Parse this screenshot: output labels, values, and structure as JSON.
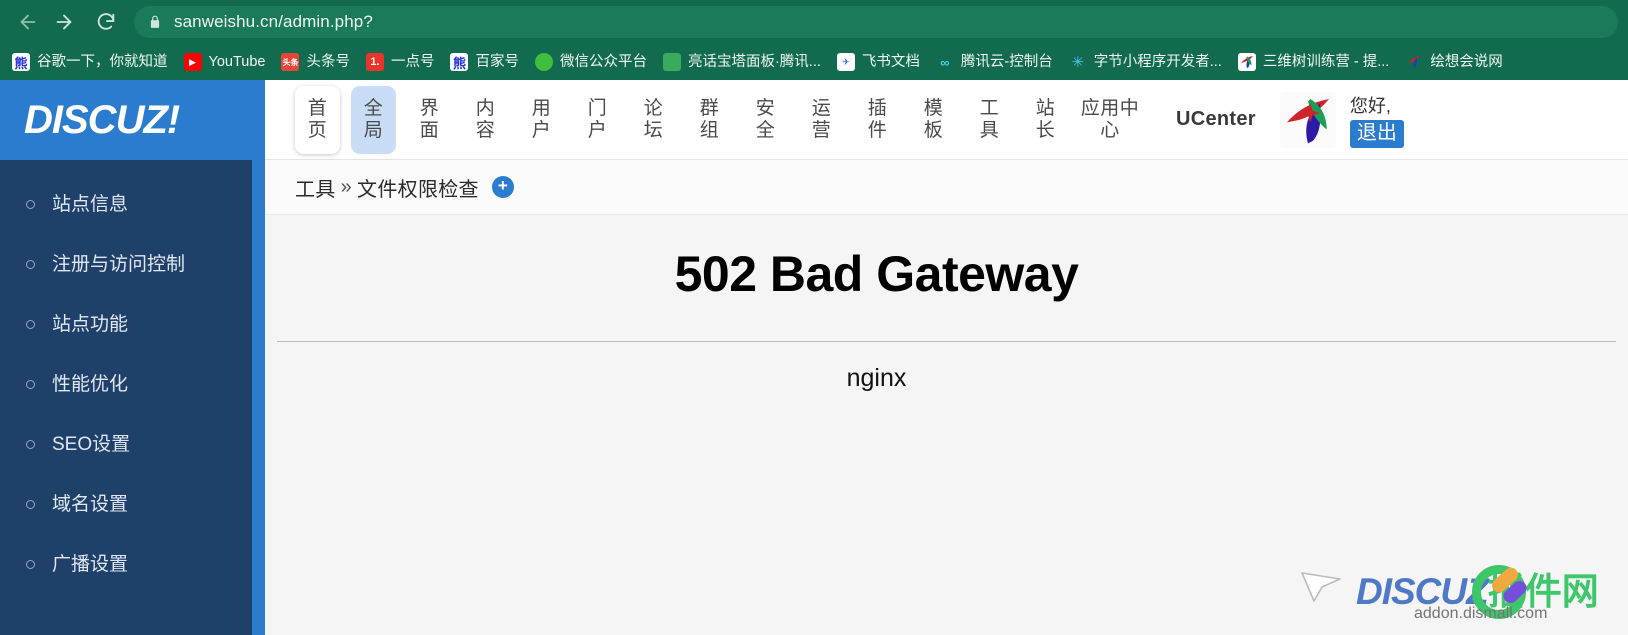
{
  "browser": {
    "url": "sanweishu.cn/admin.php?",
    "back_icon": "back-arrow-icon",
    "forward_icon": "forward-arrow-icon",
    "reload_icon": "reload-icon",
    "lock_icon": "lock-icon",
    "chrome_color": "#126b4e",
    "bookmarks": [
      {
        "label": "谷歌一下，你就知道",
        "icon": "baidu-icon",
        "glyph": "熊",
        "cls": "ico-baidu"
      },
      {
        "label": "YouTube",
        "icon": "youtube-icon",
        "glyph": "▶",
        "cls": "ico-youtube"
      },
      {
        "label": "头条号",
        "icon": "toutiao-icon",
        "glyph": "头条",
        "cls": "ico-toutiao"
      },
      {
        "label": "一点号",
        "icon": "yidian-icon",
        "glyph": "1.",
        "cls": "ico-yidian"
      },
      {
        "label": "百家号",
        "icon": "baijiahao-icon",
        "glyph": "熊",
        "cls": "ico-baidu"
      },
      {
        "label": "微信公众平台",
        "icon": "wechat-icon",
        "glyph": "",
        "cls": "ico-wechat"
      },
      {
        "label": "亮话宝塔面板·腾讯...",
        "icon": "baota-icon",
        "glyph": "",
        "cls": "ico-bt"
      },
      {
        "label": "飞书文档",
        "icon": "feishu-icon",
        "glyph": "✈",
        "cls": "ico-feishu"
      },
      {
        "label": "腾讯云-控制台",
        "icon": "tencent-cloud-icon",
        "glyph": "∞",
        "cls": "ico-tencent"
      },
      {
        "label": "字节小程序开发者...",
        "icon": "bytedance-icon",
        "glyph": "✳",
        "cls": "ico-bytedance"
      },
      {
        "label": "三维树训练营 - 提...",
        "icon": "sanweishu-icon",
        "glyph": "",
        "cls": "ico-swt"
      },
      {
        "label": "绘想会说网",
        "icon": "huixiang-icon",
        "glyph": "",
        "cls": "ico-hx"
      }
    ]
  },
  "app": {
    "logo": "DISCUZ!",
    "logo_bg": "#2b7bce",
    "sidebar_bg": "#1f4068",
    "nav_tabs": [
      {
        "l1": "首",
        "l2": "页",
        "state": "home"
      },
      {
        "l1": "全",
        "l2": "局",
        "state": "active"
      },
      {
        "l1": "界",
        "l2": "面",
        "state": ""
      },
      {
        "l1": "内",
        "l2": "容",
        "state": ""
      },
      {
        "l1": "用",
        "l2": "户",
        "state": ""
      },
      {
        "l1": "门",
        "l2": "户",
        "state": ""
      },
      {
        "l1": "论",
        "l2": "坛",
        "state": ""
      },
      {
        "l1": "群",
        "l2": "组",
        "state": ""
      },
      {
        "l1": "安",
        "l2": "全",
        "state": ""
      },
      {
        "l1": "运",
        "l2": "营",
        "state": ""
      },
      {
        "l1": "插",
        "l2": "件",
        "state": ""
      },
      {
        "l1": "模",
        "l2": "板",
        "state": ""
      },
      {
        "l1": "工",
        "l2": "具",
        "state": ""
      },
      {
        "l1": "站",
        "l2": "长",
        "state": ""
      },
      {
        "l1": "应用中",
        "l2": "心",
        "state": "wide"
      }
    ],
    "ucenter_label": "UCenter",
    "ucenter_logo_icon": "ucenter-logo-icon",
    "user_greeting": "您好,",
    "logout_label": "退出",
    "sidebar_items": [
      {
        "label": "站点信息"
      },
      {
        "label": "注册与访问控制"
      },
      {
        "label": "站点功能"
      },
      {
        "label": "性能优化"
      },
      {
        "label": "SEO设置"
      },
      {
        "label": "域名设置"
      },
      {
        "label": "广播设置"
      }
    ],
    "breadcrumb": {
      "root": "工具",
      "separator": "»",
      "current": "文件权限检查",
      "add_label": "+"
    }
  },
  "error_page": {
    "title": "502 Bad Gateway",
    "server": "nginx"
  },
  "watermark": {
    "brand_latin": "DISCUZ",
    "brand_cn": "插件网",
    "url": "addon.dismall.com",
    "cursor_icon": "mouse-cursor-icon"
  }
}
